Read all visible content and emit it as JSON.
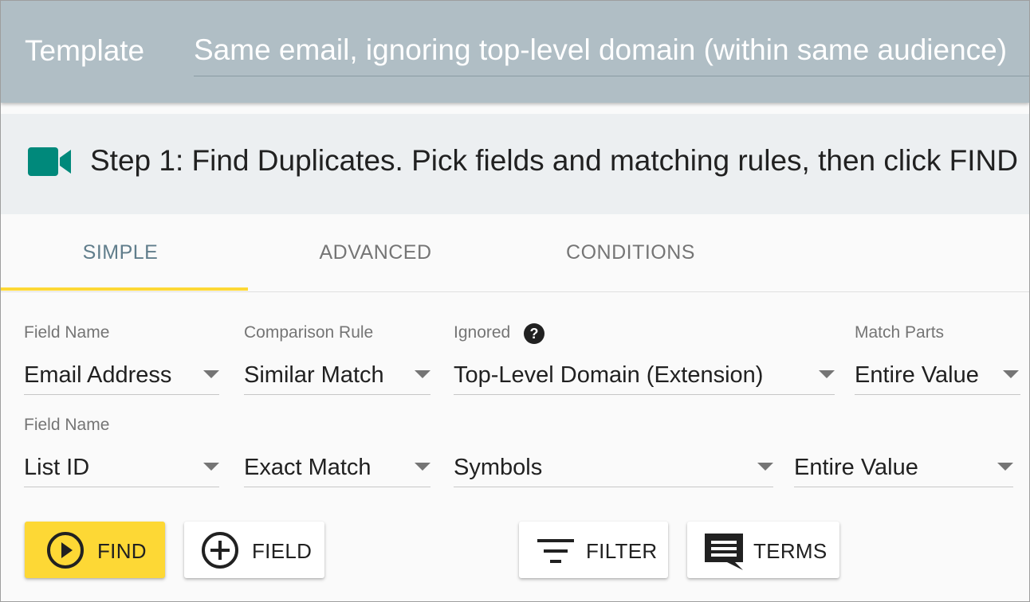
{
  "header": {
    "label": "Template",
    "template_value": "Same email, ignoring top-level domain (within same audience)"
  },
  "step": {
    "icon": "video-camera-icon",
    "text": "Step 1: Find Duplicates. Pick fields and matching rules, then click FIND"
  },
  "tabs": [
    {
      "label": "SIMPLE",
      "active": true
    },
    {
      "label": "ADVANCED",
      "active": false
    },
    {
      "label": "CONDITIONS",
      "active": false
    }
  ],
  "rows": [
    {
      "field_name_label": "Field Name",
      "field_name": "Email Address",
      "comparison_rule_label": "Comparison Rule",
      "comparison_rule": "Similar Match",
      "ignored_label": "Ignored",
      "ignored": "Top-Level Domain (Extension)",
      "match_parts_label": "Match Parts",
      "match_parts": "Entire Value"
    },
    {
      "field_name_label": "Field Name",
      "field_name": "List ID",
      "comparison_rule": "Exact Match",
      "ignored": "Symbols",
      "match_parts": "Entire Value"
    }
  ],
  "buttons": {
    "find": "FIND",
    "field": "FIELD",
    "filter": "FILTER",
    "terms": "TERMS"
  },
  "colors": {
    "header_bg": "#b0bec5",
    "accent_yellow": "#fdd835",
    "icon_teal": "#00897b",
    "active_tab": "#607d8b"
  }
}
